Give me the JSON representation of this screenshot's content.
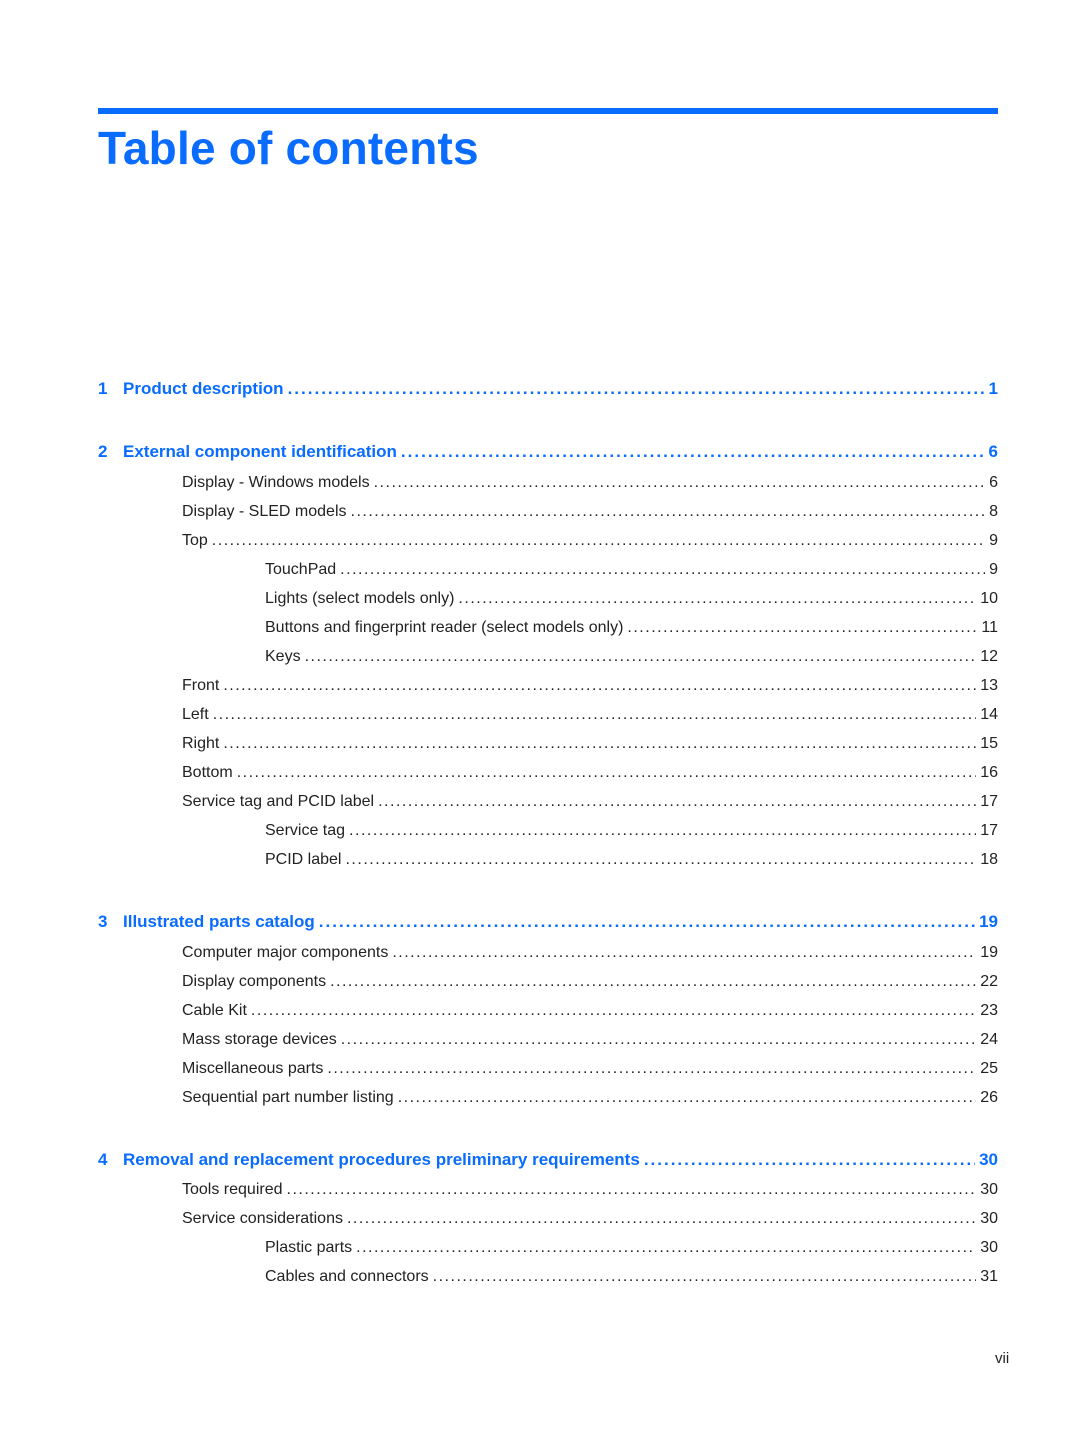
{
  "header": {
    "title": "Table of contents"
  },
  "colors": {
    "accent": "#0a6cff",
    "text": "#222222"
  },
  "toc": [
    {
      "level": 0,
      "number": "1",
      "label": "Product description",
      "page": "1"
    },
    {
      "level": 0,
      "number": "2",
      "label": "External component identification",
      "page": "6"
    },
    {
      "level": 1,
      "label": "Display - Windows models",
      "page": "6"
    },
    {
      "level": 1,
      "label": "Display - SLED models",
      "page": "8"
    },
    {
      "level": 1,
      "label": "Top",
      "page": "9"
    },
    {
      "level": 2,
      "label": "TouchPad",
      "page": "9"
    },
    {
      "level": 2,
      "label": "Lights (select models only)",
      "page": "10"
    },
    {
      "level": 2,
      "label": "Buttons and fingerprint reader (select models only)",
      "page": "11"
    },
    {
      "level": 2,
      "label": "Keys",
      "page": "12"
    },
    {
      "level": 1,
      "label": "Front",
      "page": "13"
    },
    {
      "level": 1,
      "label": "Left",
      "page": "14"
    },
    {
      "level": 1,
      "label": "Right",
      "page": "15"
    },
    {
      "level": 1,
      "label": "Bottom",
      "page": "16"
    },
    {
      "level": 1,
      "label": "Service tag and PCID label",
      "page": "17"
    },
    {
      "level": 2,
      "label": "Service tag",
      "page": "17"
    },
    {
      "level": 2,
      "label": "PCID label",
      "page": "18"
    },
    {
      "level": 0,
      "number": "3",
      "label": "Illustrated parts catalog",
      "page": "19"
    },
    {
      "level": 1,
      "label": "Computer major components",
      "page": "19"
    },
    {
      "level": 1,
      "label": "Display components",
      "page": "22"
    },
    {
      "level": 1,
      "label": "Cable Kit",
      "page": "23"
    },
    {
      "level": 1,
      "label": "Mass storage devices",
      "page": "24"
    },
    {
      "level": 1,
      "label": "Miscellaneous parts",
      "page": "25"
    },
    {
      "level": 1,
      "label": "Sequential part number listing",
      "page": "26"
    },
    {
      "level": 0,
      "number": "4",
      "label": "Removal and replacement procedures preliminary requirements",
      "page": "30"
    },
    {
      "level": 1,
      "label": "Tools required",
      "page": "30"
    },
    {
      "level": 1,
      "label": "Service considerations",
      "page": "30"
    },
    {
      "level": 2,
      "label": "Plastic parts",
      "page": "30"
    },
    {
      "level": 2,
      "label": "Cables and connectors",
      "page": "31"
    }
  ],
  "footer": {
    "folio": "vii"
  }
}
